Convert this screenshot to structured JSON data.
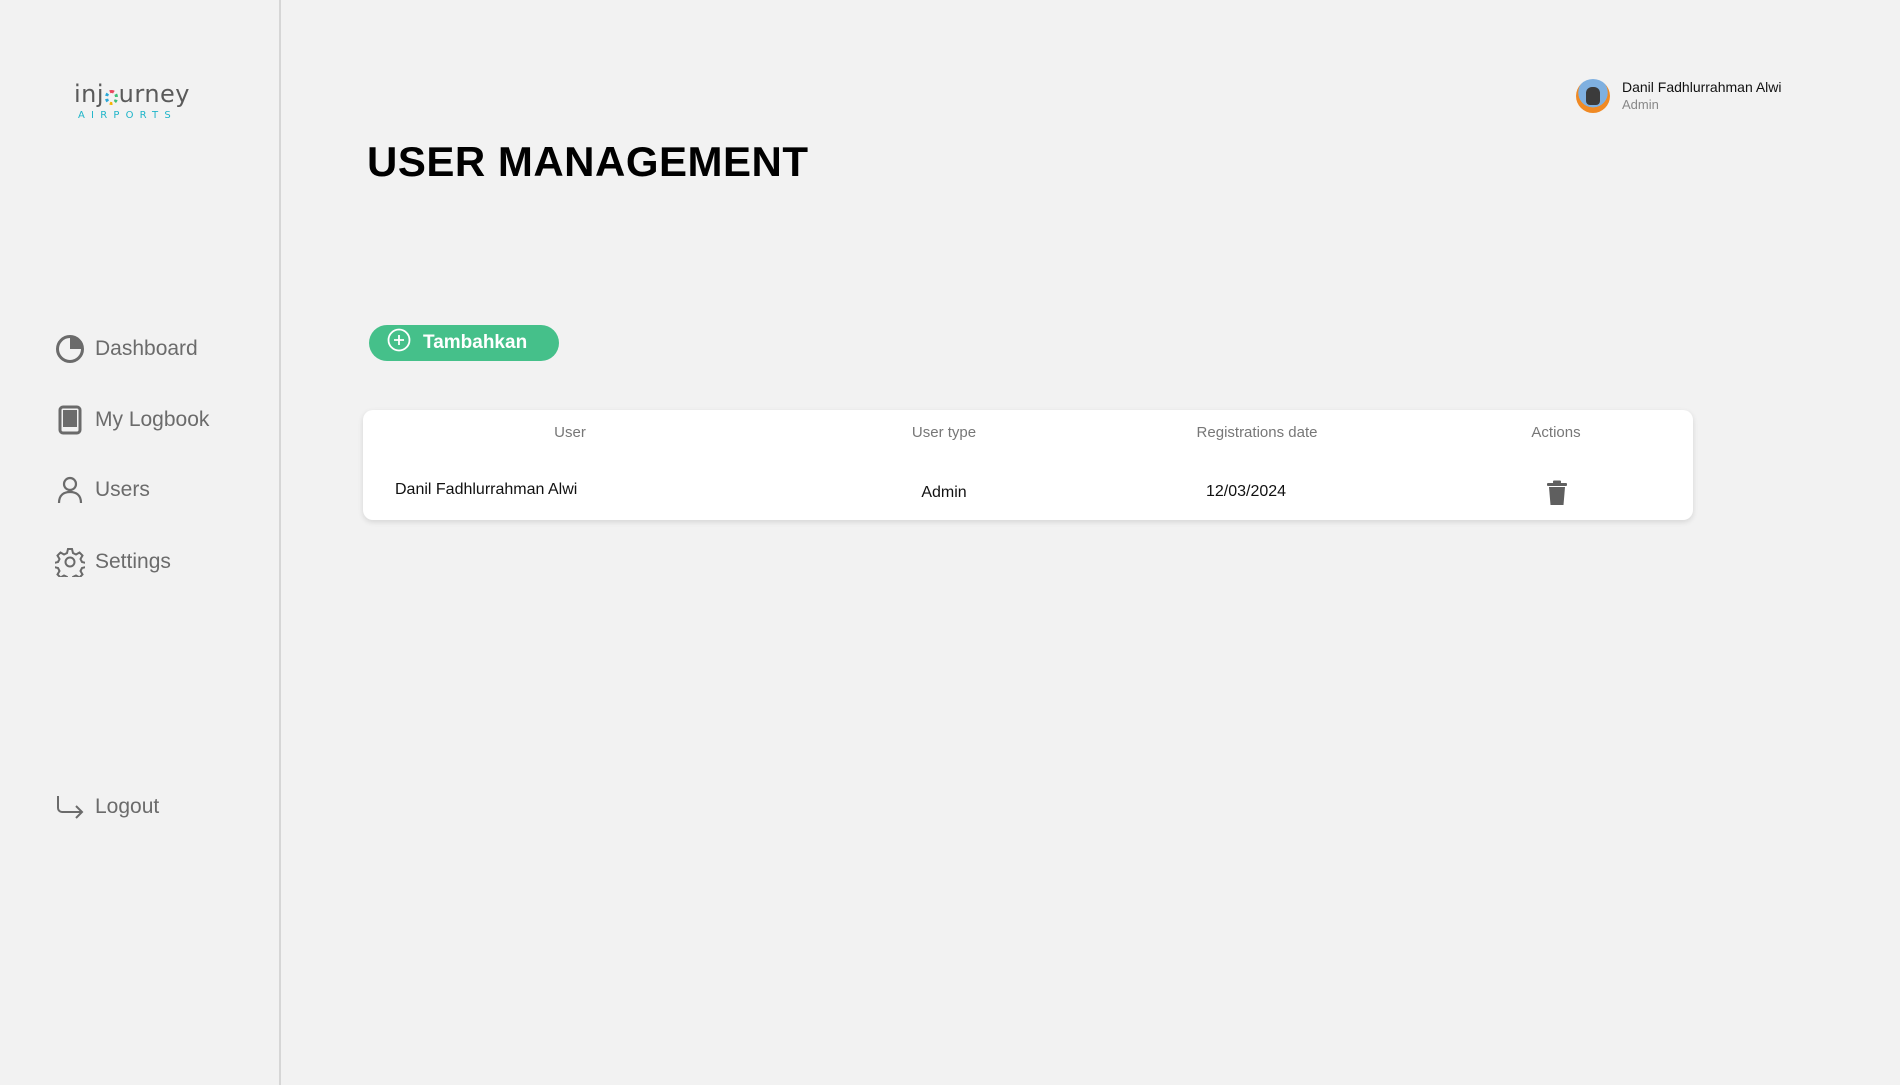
{
  "brand": {
    "word_before": "inj",
    "word_after": "urney",
    "sub": "AIRPORTS"
  },
  "sidebar": {
    "items": [
      {
        "label": "Dashboard",
        "icon": "pie-chart-icon"
      },
      {
        "label": "My Logbook",
        "icon": "book-icon"
      },
      {
        "label": "Users",
        "icon": "user-icon"
      },
      {
        "label": "Settings",
        "icon": "gear-icon"
      }
    ],
    "logout": {
      "label": "Logout",
      "icon": "logout-arrow-icon"
    }
  },
  "header": {
    "user_name": "Danil Fadhlurrahman Alwi",
    "user_role": "Admin"
  },
  "main": {
    "title": "USER MANAGEMENT",
    "add_button_label": "Tambahkan",
    "table": {
      "columns": [
        "User",
        "User type",
        "Registrations date",
        "Actions"
      ],
      "rows": [
        {
          "user": "Danil Fadhlurrahman Alwi",
          "user_type": "Admin",
          "registration_date": "12/03/2024",
          "action_icon": "trash-icon"
        }
      ]
    }
  },
  "colors": {
    "background": "#f2f2f2",
    "accent_green": "#45c08a",
    "logo_teal": "#1fb5c9",
    "nav_text": "#6b6b6b"
  }
}
